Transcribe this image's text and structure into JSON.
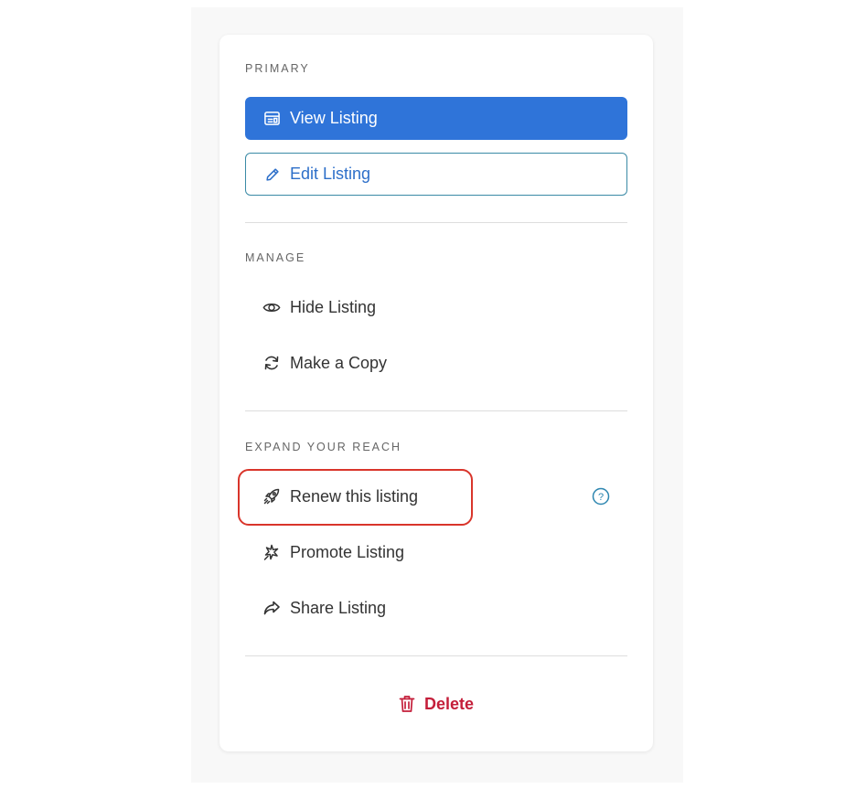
{
  "sections": {
    "primary": {
      "label": "PRIMARY",
      "view_label": "View Listing",
      "edit_label": "Edit Listing"
    },
    "manage": {
      "label": "MANAGE",
      "items": [
        {
          "label": "Hide Listing",
          "icon": "eye-icon"
        },
        {
          "label": "Make a Copy",
          "icon": "refresh-icon"
        }
      ]
    },
    "expand": {
      "label": "EXPAND YOUR REACH",
      "items": [
        {
          "label": "Renew this listing",
          "icon": "rocket-icon"
        },
        {
          "label": "Promote Listing",
          "icon": "sparkle-icon"
        },
        {
          "label": "Share Listing",
          "icon": "share-icon"
        }
      ],
      "help_icon": "question-circle-icon"
    }
  },
  "delete": {
    "label": "Delete",
    "icon": "trash-icon"
  },
  "colors": {
    "primary_button": "#2f74d9",
    "secondary_button_text": "#2d6fc9",
    "highlight": "#d9352b",
    "delete": "#c41e3a",
    "help": "#2d86b0"
  }
}
